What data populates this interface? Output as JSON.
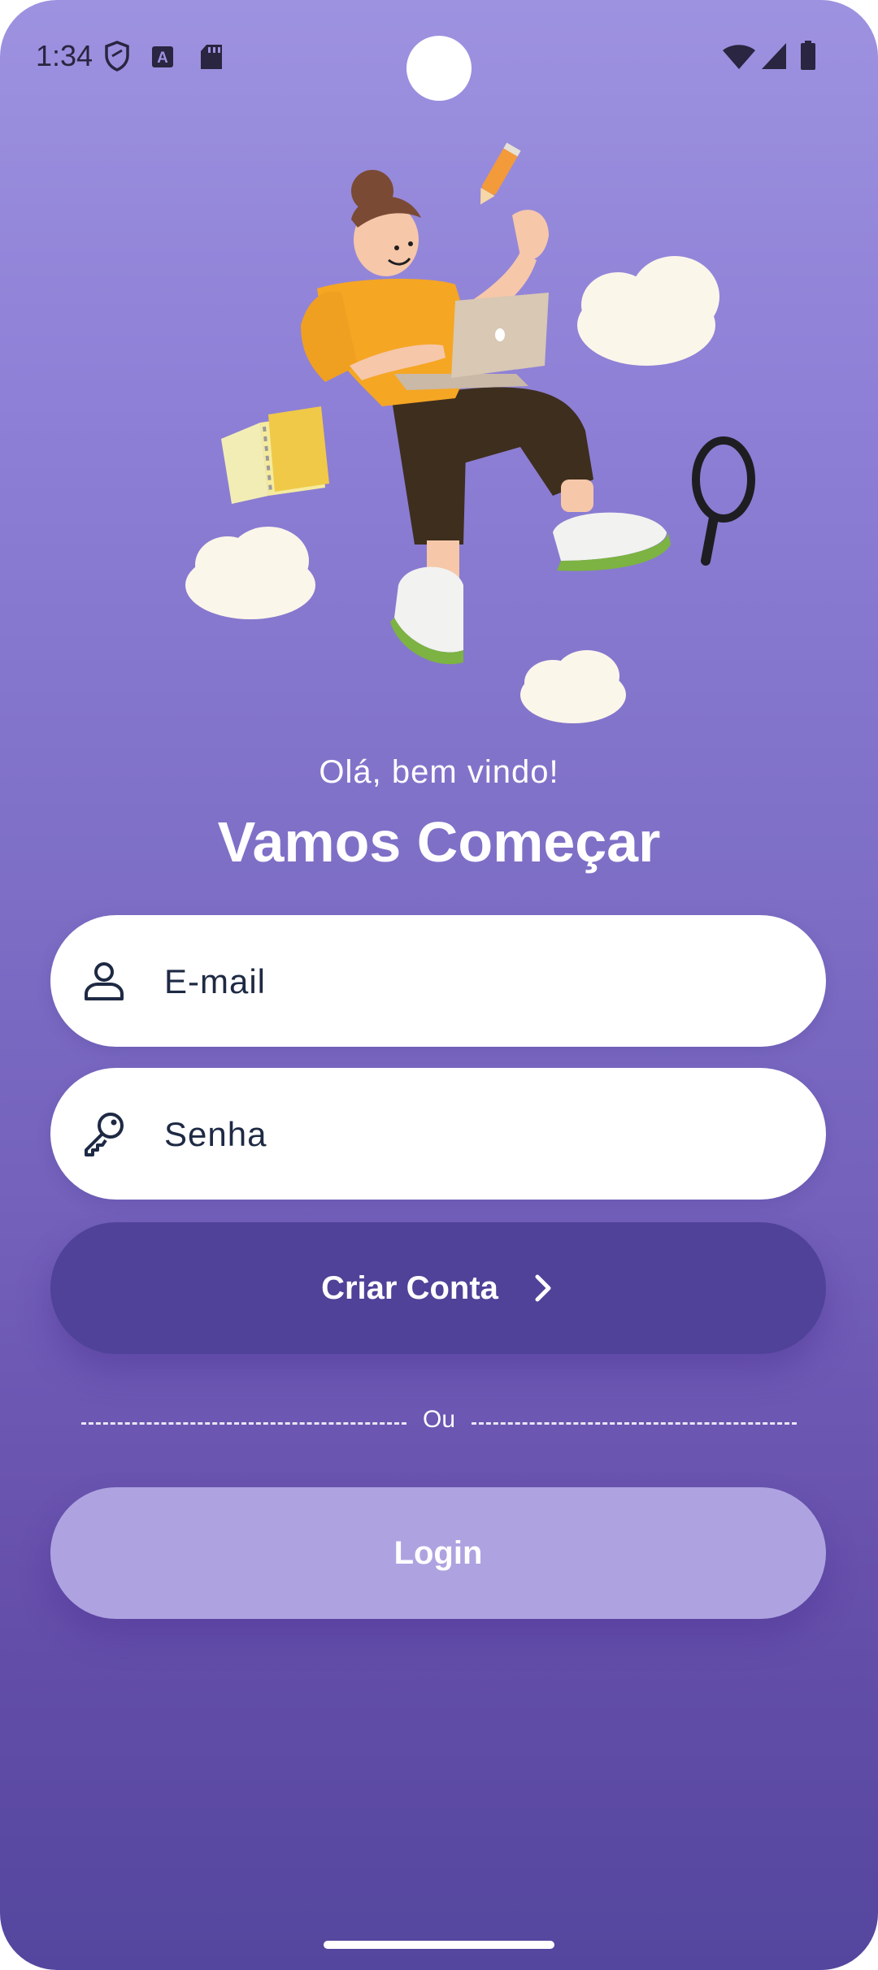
{
  "status_bar": {
    "time": "1:34",
    "left_icons": [
      "shield-icon",
      "keyboard-a-icon",
      "sd-card-icon"
    ],
    "right_icons": [
      "wifi-icon",
      "signal-icon",
      "battery-icon"
    ]
  },
  "hero": {
    "illustration": "person-with-laptop-illustration",
    "greeting": "Olá, bem vindo!",
    "title": "Vamos Começar"
  },
  "form": {
    "email": {
      "placeholder": "E-mail",
      "value": "",
      "icon": "user-icon"
    },
    "password": {
      "placeholder": "Senha",
      "value": "",
      "icon": "key-icon"
    },
    "create_account_label": "Criar Conta",
    "divider_label": "Ou",
    "login_label": "Login"
  },
  "colors": {
    "gradient_top": "#9d92e0",
    "gradient_bottom": "#54469e",
    "primary_button": "#4f4298",
    "login_button": "#aea3e0",
    "field_text": "#1e2a44"
  }
}
